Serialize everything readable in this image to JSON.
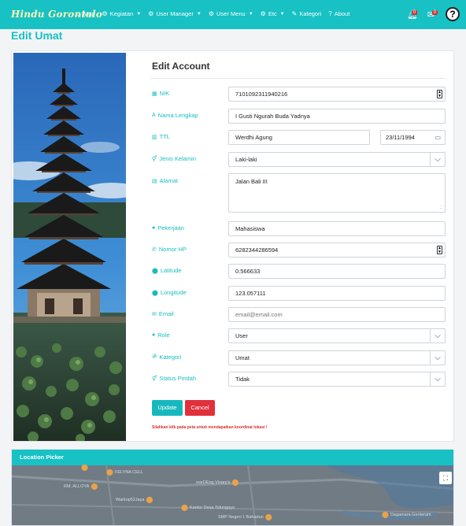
{
  "nav": {
    "brand": "Hindu Gorontalo",
    "items": [
      {
        "icon": "home-icon",
        "glyph": "⌂",
        "label": "Map",
        "caret": false
      },
      {
        "icon": "gear-icon",
        "glyph": "⚙",
        "label": "Kegiatan",
        "caret": true
      },
      {
        "icon": "gear-icon",
        "glyph": "⚙",
        "label": "User Manager",
        "caret": true
      },
      {
        "icon": "gear-icon",
        "glyph": "⚙",
        "label": "User Menu",
        "caret": true
      },
      {
        "icon": "gear-icon",
        "glyph": "⚙",
        "label": "Etc",
        "caret": true
      },
      {
        "icon": "edit-icon",
        "glyph": "✎",
        "label": "Kategori",
        "caret": false
      },
      {
        "icon": "question-icon",
        "glyph": "?",
        "label": "About",
        "caret": false
      }
    ],
    "bell_count": "0",
    "mail_count": "0",
    "help_glyph": "?"
  },
  "page": {
    "title": "Edit Umat"
  },
  "form": {
    "title": "Edit Account",
    "labels": {
      "nik": "NIK",
      "nama": "Nama Lengkap",
      "ttl": "TTL",
      "jenis_kelamin": "Jenis Kelamin",
      "alamat": "Alamat",
      "pekerjaan": "Pekerjaan",
      "nomor_hp": "Nomor HP",
      "latitude": "Latitude",
      "longitude": "Longitude",
      "email": "Email",
      "role": "Role",
      "kategori": "Kategori",
      "status_pindah": "Status Pindah"
    },
    "values": {
      "nik": "7101092311940216",
      "nama": "I Gusti Ngurah Buda Yadnya",
      "tempat_lahir": "Werdhi Agung",
      "tanggal_lahir": "23/11/1994",
      "jenis_kelamin": "Laki-laki",
      "alamat": "Jalan Bali III",
      "pekerjaan": "Mahasiswa",
      "nomor_hp": "6282344286594",
      "latitude": "0.566633",
      "longitude": "123.057111",
      "email": "",
      "role": "User",
      "kategori": "Umat",
      "status_pindah": "Tidak"
    },
    "placeholders": {
      "email": "email@email.com"
    },
    "buttons": {
      "update": "Update",
      "cancel": "Cancel"
    },
    "hint": "Silahkan klik pada peta untuk mendapatkan koordinat lokasi !"
  },
  "location": {
    "title": "Location Picker",
    "map_labels": [
      "FELYNA CELL",
      "RM. ALLOYA",
      "warDEng Vinary's",
      "Warkop52Jaya",
      "Kantor Desa Tolungayo",
      "SMP Negeri 1 Bahaduo",
      "Dagamara Genteram"
    ]
  },
  "colors": {
    "accent": "#17c1c4",
    "danger": "#e0303b"
  }
}
